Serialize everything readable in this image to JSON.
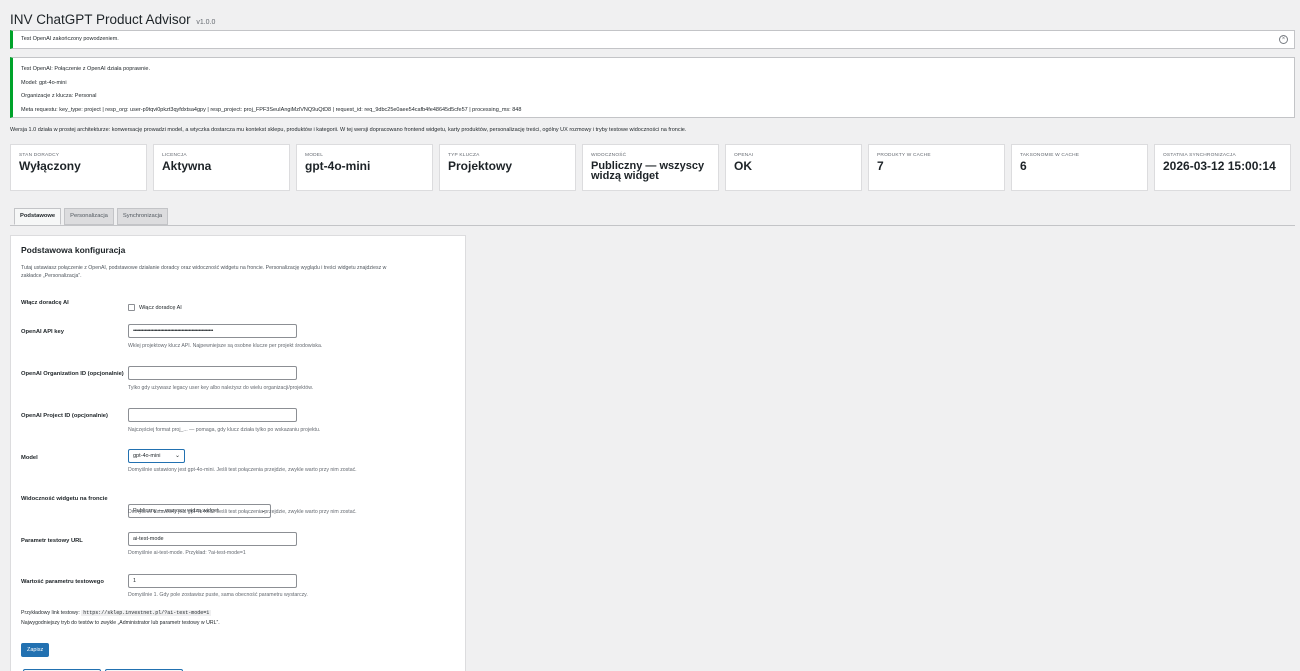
{
  "header": {
    "title": "INV ChatGPT Product Advisor",
    "version": "v1.0.0"
  },
  "notice_success": {
    "text": "Test OpenAI zakończony powodzeniem.",
    "dismiss_icon": "×"
  },
  "notice_details": {
    "lines": [
      "Test OpenAI: Połączenie z OpenAI działa poprawnie.",
      "Model: gpt-4o-mini",
      "Organizacje z klucza: Personal",
      "Meta requestu: key_type: project | resp_org: user-p9tqvi0pkzt3qyfdxtsa4gpy | resp_project: proj_FPF3SeuIAngiMzlVNQ9uQtD8 | request_id: req_9dbc25e0aee54cafb4fe48645d5cfe57 | processing_ms: 848"
    ]
  },
  "intro": "Wersja 1.0 działa w prostej architekturze: konwersację prowadzi model, a wtyczka dostarcza mu kontekst sklepu, produktów i kategorii. W tej wersji dopracowano frontend widgetu, karty produktów, personalizację treści, ogólny UX rozmowy i tryby testowe widoczności na froncie.",
  "cards": [
    {
      "label": "Stan doradcy",
      "value": "Wyłączony"
    },
    {
      "label": "Licencja",
      "value": "Aktywna"
    },
    {
      "label": "Model",
      "value": "gpt-4o-mini"
    },
    {
      "label": "Typ klucza",
      "value": "Projektowy"
    },
    {
      "label": "Widoczność",
      "value": "Publiczny — wszyscy widzą widget"
    },
    {
      "label": "OpenAI",
      "value": "OK"
    },
    {
      "label": "Produkty w cache",
      "value": "7"
    },
    {
      "label": "Taksonomie w cache",
      "value": "6"
    },
    {
      "label": "Ostatnia synchronizacja",
      "value": "2026-03-12 15:00:14"
    }
  ],
  "tabs": [
    {
      "label": "Podstawowe",
      "active": true
    },
    {
      "label": "Personalizacja",
      "active": false
    },
    {
      "label": "Synchronizacja",
      "active": false
    }
  ],
  "panel": {
    "title": "Podstawowa konfiguracja",
    "desc": "Tutaj ustawiasz połączenie z OpenAI, podstawowe działanie doradcy oraz widoczność widgetu na froncie. Personalizację wyglądu i treści widgetu znajdziesz w zakładce „Personalizacja”.",
    "enable": {
      "label": "Włącz doradcę AI",
      "checkbox_label": "Włącz doradcę AI",
      "checked": false
    },
    "api_key": {
      "label": "OpenAI API key",
      "value": "••••••••••••••••••••••••••••••••••••••••••••••••••••••••",
      "help": "Wklej projektowy klucz API. Najpewniejsze są osobne klucze per projekt środowiska."
    },
    "org_id": {
      "label": "OpenAI Organization ID (opcjonalnie)",
      "value": "",
      "help": "Tylko gdy używasz legacy user key albo należysz do wielu organizacji/projektów."
    },
    "project_id": {
      "label": "OpenAI Project ID (opcjonalnie)",
      "value": "",
      "help": "Najczęściej format proj_... — pomaga, gdy klucz działa tylko po wskazaniu projektu."
    },
    "model": {
      "label": "Model",
      "value": "gpt-4o-mini",
      "help": "Domyślnie ustawiony jest gpt-4o-mini. Jeśli test połączenia przejdzie, zwykle warto przy nim zostać."
    },
    "visibility": {
      "label": "Widoczność widgetu na froncie",
      "value": "Publiczny — wszyscy widzą widget",
      "help": "Domyślnie ustawiony jest gpt-4o-mini. Jeśli test połączenia przejdzie, zwykle warto przy nim zostać."
    },
    "test_param": {
      "label": "Parametr testowy URL",
      "value": "ai-test-mode",
      "help": "Domyślnie ai-test-mode. Przykład: ?ai-test-mode=1"
    },
    "test_value": {
      "label": "Wartość parametru testowego",
      "value": "1",
      "help": "Domyślnie 1. Gdy pole zostawisz puste, sama obecność parametru wystarczy."
    },
    "example_label": "Przykładowy link testowy:",
    "example_url": "https://sklep.investnet.pl/?ai-test-mode=1",
    "example_note": "Najwygodniejszy tryb do testów to zwykle „Administrator lub parametr testowy w URL”.",
    "save_label": "Zapisz"
  }
}
